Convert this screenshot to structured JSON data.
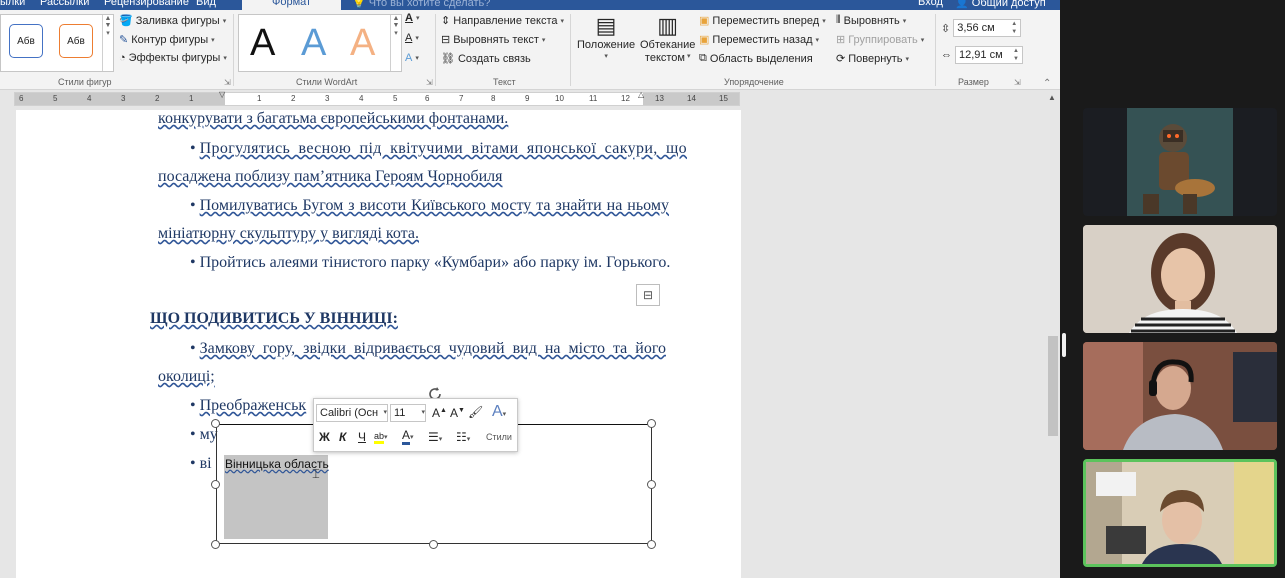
{
  "tabs": [
    {
      "label": "ылки",
      "active": false
    },
    {
      "label": "Рассылки",
      "active": false
    },
    {
      "label": "Рецензирование",
      "active": false
    },
    {
      "label": "Вид",
      "active": false
    },
    {
      "label": "Формат",
      "active": true
    },
    {
      "label": "Что вы хотите сделать?",
      "active": false
    }
  ],
  "account": {
    "signin": "Вход",
    "share": "Общий доступ"
  },
  "ribbon": {
    "shape_styles": {
      "group_label": "Стили фигур",
      "sample1": "Абв",
      "sample2": "Абв",
      "fill": "Заливка фигуры",
      "outline": "Контур фигуры",
      "effects": "Эффекты фигуры"
    },
    "wordart": {
      "group_label": "Стили WordArt",
      "letter": "A"
    },
    "text": {
      "group_label": "Текст",
      "direction": "Направление текста",
      "align": "Выровнять текст",
      "link": "Создать связь"
    },
    "arrange": {
      "group_label": "Упорядочение",
      "position": "Положение",
      "wrap_line1": "Обтекание",
      "wrap_line2": "текстом",
      "forward": "Переместить вперед",
      "backward": "Переместить назад",
      "selection": "Область выделения",
      "align": "Выровнять",
      "group": "Группировать",
      "rotate": "Повернуть"
    },
    "size": {
      "group_label": "Размер",
      "height": "3,56 см",
      "width": "12,91 см"
    }
  },
  "ruler": {
    "left_ticks": [
      "6",
      "5",
      "4",
      "3",
      "2",
      "1"
    ],
    "right_ticks": [
      "1",
      "2",
      "3",
      "4",
      "5",
      "6",
      "7",
      "8",
      "9",
      "10",
      "11",
      "12",
      "13",
      "14",
      "15"
    ]
  },
  "document": {
    "line1": "конкурувати з багатьма європейськими фонтанами.",
    "bullet": "•",
    "b1_line1": "Прогулятись весною під квітучими вітами японської сакури, що",
    "b1_line2": "посаджена поблизу пам’ятника Героям Чорнобиля",
    "b2_line1": "Помилуватись Бугом з висоти Київського мосту та знайти на ньому",
    "b2_line2": "мініатюрну скульптуру у вигляді кота.",
    "b3_line1": "Пройтись алеями тінистого парку «Кумбари» або парку ім. Горького.",
    "heading": "ЩО ПОДИВИТИСЬ У ВІННИЦІ:",
    "b4_line1": "Замкову гору, звідки відривається чудовий вид на місто та його",
    "b4_line2": "околиці;",
    "b5_partial": "Преображенськ",
    "b6_partial": "му",
    "b7_partial": "ві",
    "shape_text": "Вінницька область"
  },
  "mini_toolbar": {
    "font": "Calibri (Осн",
    "size": "11",
    "bold": "Ж",
    "italic": "К",
    "underline": "Ч",
    "styles": "Стили"
  },
  "colors": {
    "tab_bar": "#2b579a",
    "doc_text": "#1f3864",
    "active_speaker": "#5cc35c"
  },
  "video_tiles": [
    {
      "name": "participant-1",
      "kind": "avatar"
    },
    {
      "name": "participant-2",
      "kind": "camera"
    },
    {
      "name": "participant-3",
      "kind": "camera"
    },
    {
      "name": "participant-4",
      "kind": "camera",
      "active_speaker": true
    }
  ]
}
